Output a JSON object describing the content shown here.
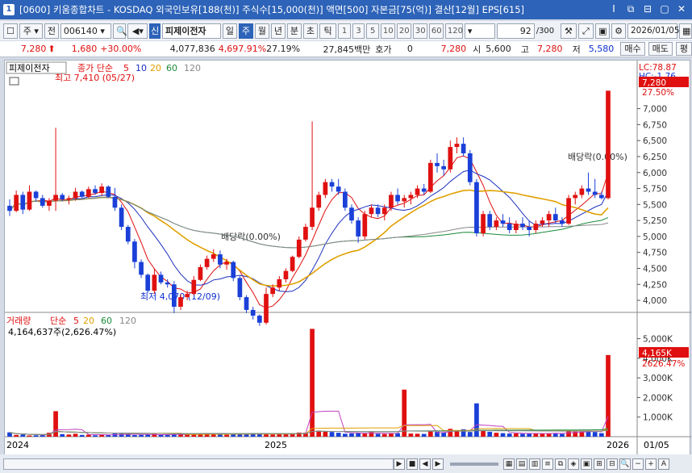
{
  "window": {
    "number": "1",
    "title": "[0600] 키움종합차트 - KOSDAQ 외국인보유[188(천)] 주식수[15,000(천)] 액면[500] 자본금[75(억)] 결산[12월] EPS[615]",
    "controls": [
      "I",
      "⧉",
      "⊟",
      "▢",
      "✕"
    ]
  },
  "toolbar": {
    "market": "주",
    "prev_label": "전",
    "code": "006140",
    "new_badge": "신",
    "stock_name": "피제이전자",
    "periods": [
      "일",
      "주",
      "월",
      "년",
      "분",
      "초",
      "틱"
    ],
    "selected_period": "주",
    "minute_options": [
      "1",
      "3",
      "5",
      "10",
      "20",
      "30",
      "60",
      "120"
    ],
    "count_value": "92",
    "count_total": "/300",
    "date": "2026/01/05"
  },
  "pricebar": {
    "price": "7,280",
    "change": "1,680",
    "change_pct": "+30.00%",
    "volume": "4,077,836",
    "volume_pct": "4,697.91%",
    "turnover": "27.19%",
    "amount": "27,845백만",
    "hoga_label": "호가",
    "hoga_value": "0",
    "hoga_price": "7,280",
    "open_label": "시",
    "open": "5,600",
    "high_label": "고",
    "high": "7,280",
    "low_label": "저",
    "low": "5,580",
    "buy_label": "매수",
    "sell_label": "매도",
    "eval_label": "평"
  },
  "chart": {
    "stock_label": "피제이전자",
    "ma_title": "종가 단순",
    "ma_periods": [
      "5",
      "10",
      "20",
      "60",
      "120"
    ],
    "ma_colors": [
      "#e01010",
      "#1a2ec0",
      "#e0a000",
      "#1a8a3a",
      "#888888"
    ],
    "high_note": "최고 7,410 (05/27)",
    "low_note": "최저 4,070 (12/09)",
    "dividend_note": "배당락(0.00%)",
    "lc_label": "LC:78.87",
    "hc_label": "HC:-1.76",
    "last_price_tag": "7,280",
    "last_pct_tag": "27.50%",
    "y_ticks": [
      "7,000",
      "6,750",
      "6,500",
      "6,250",
      "6,000",
      "5,750",
      "5,500",
      "5,250",
      "5,000",
      "4,750",
      "4,500",
      "4,250",
      "4,000"
    ],
    "volume_title": "거래량",
    "volume_ma_title": "단순",
    "volume_info": "4,164,637주(2,626.47%)",
    "volume_ticks": [
      "5,000K",
      "4,000K",
      "3,000K",
      "2,000K",
      "1,000K"
    ],
    "volume_tag": "4,165K",
    "volume_pct_tag": "2626.47%",
    "x_labels": [
      "2024",
      "2025",
      "2026"
    ],
    "x_right_label": "01/05"
  },
  "chart_data": {
    "type": "candlestick",
    "unit": "KRW",
    "ylim": [
      3900,
      7500
    ],
    "candles": [
      [
        5480,
        5580,
        5320,
        5400
      ],
      [
        5400,
        5720,
        5380,
        5650
      ],
      [
        5650,
        5700,
        5350,
        5420
      ],
      [
        5420,
        5800,
        5400,
        5700
      ],
      [
        5700,
        5720,
        5550,
        5600
      ],
      [
        5600,
        5650,
        5450,
        5480
      ],
      [
        5480,
        5600,
        5400,
        5560
      ],
      [
        5560,
        6700,
        5400,
        5650
      ],
      [
        5650,
        5680,
        5550,
        5580
      ],
      [
        5580,
        5640,
        5500,
        5600
      ],
      [
        5600,
        5760,
        5560,
        5700
      ],
      [
        5700,
        5720,
        5600,
        5620
      ],
      [
        5620,
        5780,
        5600,
        5740
      ],
      [
        5740,
        5800,
        5650,
        5680
      ],
      [
        5680,
        5830,
        5640,
        5780
      ],
      [
        5780,
        5800,
        5600,
        5620
      ],
      [
        5620,
        5760,
        5400,
        5450
      ],
      [
        5450,
        5500,
        5100,
        5150
      ],
      [
        5150,
        5180,
        4880,
        4920
      ],
      [
        4920,
        4960,
        4500,
        4600
      ],
      [
        4600,
        4640,
        4350,
        4400
      ],
      [
        4400,
        4420,
        4120,
        4150
      ],
      [
        4150,
        4500,
        4100,
        4400
      ],
      [
        4400,
        4450,
        4250,
        4280
      ],
      [
        4280,
        4330,
        4200,
        4250
      ],
      [
        4250,
        4300,
        3800,
        3900
      ],
      [
        3900,
        4100,
        3850,
        4050
      ],
      [
        4050,
        4150,
        4000,
        4100
      ],
      [
        4100,
        4380,
        4080,
        4320
      ],
      [
        4320,
        4560,
        4300,
        4520
      ],
      [
        4520,
        4700,
        4480,
        4650
      ],
      [
        4650,
        4800,
        4600,
        4720
      ],
      [
        4720,
        4780,
        4500,
        4560
      ],
      [
        4560,
        4650,
        4480,
        4600
      ],
      [
        4600,
        4620,
        4300,
        4350
      ],
      [
        4350,
        4380,
        4000,
        4050
      ],
      [
        4050,
        4080,
        3800,
        3850
      ],
      [
        3850,
        3900,
        3700,
        3760
      ],
      [
        3760,
        3780,
        3600,
        3650
      ],
      [
        3650,
        4200,
        3620,
        4100
      ],
      [
        4100,
        4250,
        4050,
        4200
      ],
      [
        4200,
        4380,
        4150,
        4330
      ],
      [
        4330,
        4500,
        4280,
        4460
      ],
      [
        4460,
        4700,
        4440,
        4680
      ],
      [
        4680,
        5000,
        4660,
        4950
      ],
      [
        4950,
        5200,
        4920,
        5150
      ],
      [
        5150,
        6800,
        5100,
        5450
      ],
      [
        5450,
        5700,
        5400,
        5650
      ],
      [
        5650,
        5900,
        5600,
        5850
      ],
      [
        5850,
        5900,
        5700,
        5780
      ],
      [
        5780,
        5900,
        5650,
        5700
      ],
      [
        5700,
        5750,
        5400,
        5450
      ],
      [
        5450,
        5500,
        5200,
        5250
      ],
      [
        5250,
        5300,
        4900,
        5000
      ],
      [
        5000,
        5400,
        4950,
        5350
      ],
      [
        5350,
        5500,
        5300,
        5450
      ],
      [
        5450,
        5500,
        5300,
        5350
      ],
      [
        5350,
        5500,
        5250,
        5450
      ],
      [
        5450,
        5700,
        5400,
        5650
      ],
      [
        5650,
        5750,
        5500,
        5550
      ],
      [
        5550,
        5650,
        5450,
        5600
      ],
      [
        5600,
        5700,
        5500,
        5650
      ],
      [
        5650,
        5800,
        5600,
        5750
      ],
      [
        5750,
        5820,
        5650,
        5700
      ],
      [
        5700,
        6200,
        5680,
        6150
      ],
      [
        6150,
        6300,
        6000,
        6100
      ],
      [
        6100,
        6200,
        5950,
        6050
      ],
      [
        6050,
        6500,
        6000,
        6400
      ],
      [
        6400,
        6550,
        6300,
        6450
      ],
      [
        6450,
        6550,
        6250,
        6300
      ],
      [
        6300,
        6350,
        5800,
        5850
      ],
      [
        5850,
        5900,
        5000,
        5050
      ],
      [
        5050,
        5400,
        5000,
        5350
      ],
      [
        5350,
        5400,
        5100,
        5150
      ],
      [
        5150,
        5300,
        5100,
        5250
      ],
      [
        5250,
        5350,
        5150,
        5200
      ],
      [
        5200,
        5300,
        5050,
        5100
      ],
      [
        5100,
        5250,
        5050,
        5200
      ],
      [
        5200,
        5300,
        5100,
        5150
      ],
      [
        5150,
        5250,
        5000,
        5100
      ],
      [
        5100,
        5250,
        5050,
        5200
      ],
      [
        5200,
        5300,
        5150,
        5250
      ],
      [
        5250,
        5400,
        5150,
        5350
      ],
      [
        5350,
        5450,
        5200,
        5250
      ],
      [
        5250,
        5300,
        5150,
        5200
      ],
      [
        5200,
        5650,
        5180,
        5600
      ],
      [
        5600,
        5700,
        5500,
        5650
      ],
      [
        5650,
        5800,
        5600,
        5750
      ],
      [
        5750,
        6000,
        5650,
        5700
      ],
      [
        5700,
        5900,
        5600,
        5650
      ],
      [
        5650,
        5700,
        5580,
        5600
      ],
      [
        5600,
        7280,
        5580,
        7280
      ]
    ],
    "volumes": [
      220,
      90,
      110,
      60,
      70,
      80,
      200,
      1300,
      130,
      110,
      150,
      90,
      100,
      70,
      110,
      80,
      160,
      150,
      120,
      80,
      90,
      110,
      140,
      100,
      80,
      120,
      150,
      130,
      150,
      170,
      180,
      170,
      140,
      100,
      120,
      140,
      150,
      180,
      170,
      120,
      110,
      130,
      140,
      170,
      210,
      200,
      5500,
      310,
      260,
      240,
      200,
      150,
      170,
      190,
      160,
      230,
      150,
      140,
      170,
      180,
      2400,
      160,
      150,
      140,
      300,
      250,
      210,
      400,
      330,
      380,
      240,
      1700,
      300,
      250,
      200,
      180,
      160,
      170,
      150,
      160,
      180,
      150,
      170,
      190,
      140,
      300,
      260,
      260,
      310,
      240,
      180,
      4165
    ],
    "volume_ylim": [
      0,
      5600
    ]
  }
}
